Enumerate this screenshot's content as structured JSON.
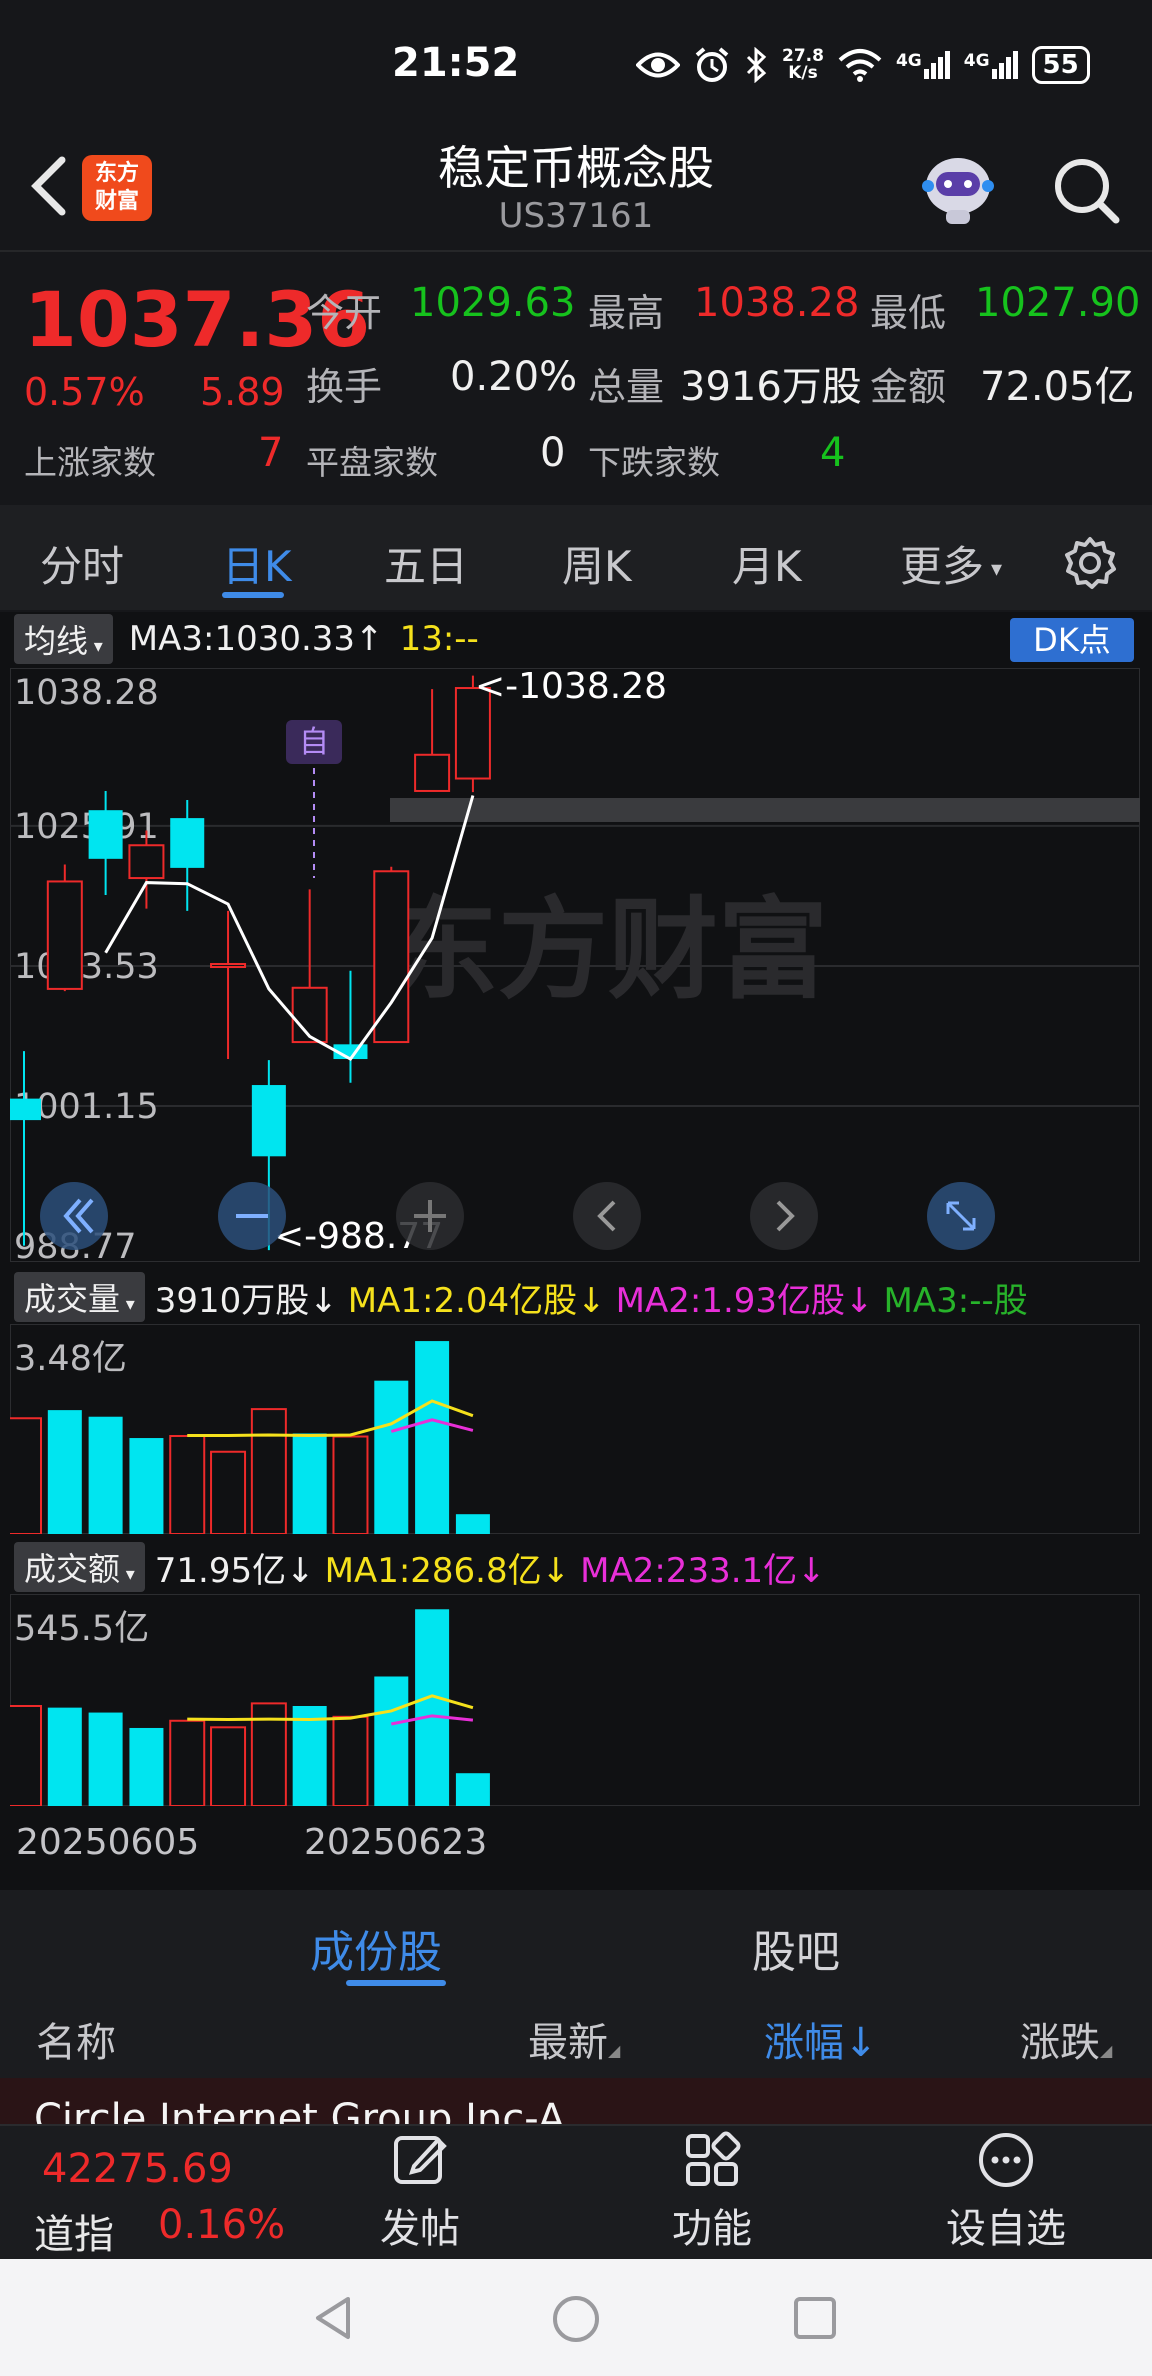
{
  "status_bar": {
    "time": "21:52",
    "net_speed_value": "27.8",
    "net_speed_unit": "K/s",
    "sim1": "4G",
    "sim2": "4G",
    "battery": "55"
  },
  "header": {
    "logo_text_1": "东方",
    "logo_text_2": "财富",
    "title": "稳定币概念股",
    "code": "US37161"
  },
  "quote": {
    "price": "1037.36",
    "change_pct": "0.57%",
    "change": "5.89",
    "open_label": "今开",
    "open": "1029.63",
    "high_label": "最高",
    "high": "1038.28",
    "low_label": "最低",
    "low": "1027.90",
    "turnover_label": "换手",
    "turnover": "0.20%",
    "volume_label": "总量",
    "volume": "3916万股",
    "amount_label": "金额",
    "amount": "72.05亿",
    "up_label": "上涨家数",
    "up_count": "7",
    "flat_label": "平盘家数",
    "flat_count": "0",
    "down_label": "下跌家数",
    "down_count": "4"
  },
  "tabs": [
    "分时",
    "日K",
    "五日",
    "周K",
    "月K",
    "更多"
  ],
  "active_tab": "日K",
  "kline": {
    "indicator_label": "均线",
    "ma3_text": "MA3:1030.33↑",
    "ma13_text": "13:--",
    "dk_label": "DK点",
    "self_marker": "自",
    "watermark": "东方财富",
    "max_label": "<-1038.28",
    "min_label": "<-988.77"
  },
  "volume_panel": {
    "label": "成交量",
    "value": "3910万股↓",
    "ma1": "MA1:2.04亿股↓",
    "ma2": "MA2:1.93亿股↓",
    "ma3": "MA3:--股",
    "axis_max": "3.48亿"
  },
  "amount_panel": {
    "label": "成交额",
    "value": "71.95亿↓",
    "ma1": "MA1:286.8亿↓",
    "ma2": "MA2:233.1亿↓",
    "axis_max": "545.5亿"
  },
  "dates": {
    "start": "20250605",
    "mid": "20250623"
  },
  "chart_data": {
    "type": "candlestick",
    "y_ticks": [
      "1038.28",
      "1025.91",
      "1013.53",
      "1001.15",
      "988.77"
    ],
    "ylim": [
      988.77,
      1038.28
    ],
    "candles": [
      {
        "open": 1001.8,
        "close": 999.9,
        "high": 1006.0,
        "low": 988.8,
        "dir": "down"
      },
      {
        "open": 1011.5,
        "close": 1021.0,
        "high": 1022.5,
        "low": 1011.3,
        "dir": "up"
      },
      {
        "open": 1027.3,
        "close": 1023.0,
        "high": 1029.0,
        "low": 1019.8,
        "dir": "down"
      },
      {
        "open": 1021.3,
        "close": 1024.2,
        "high": 1025.5,
        "low": 1018.6,
        "dir": "up"
      },
      {
        "open": 1026.6,
        "close": 1022.2,
        "high": 1028.2,
        "low": 1018.4,
        "dir": "down"
      },
      {
        "open": 1013.7,
        "close": 1013.7,
        "high": 1018.4,
        "low": 1005.3,
        "dir": "up"
      },
      {
        "open": 1003.0,
        "close": 996.7,
        "high": 1005.2,
        "low": 988.4,
        "dir": "down"
      },
      {
        "open": 1006.8,
        "close": 1011.6,
        "high": 1020.3,
        "low": 1006.8,
        "dir": "up"
      },
      {
        "open": 1005.3,
        "close": 1006.6,
        "high": 1013.1,
        "low": 1003.2,
        "dir": "down"
      },
      {
        "open": 1006.8,
        "close": 1021.9,
        "high": 1022.3,
        "low": 1006.8,
        "dir": "up"
      },
      {
        "open": 1029.0,
        "close": 1032.2,
        "high": 1038.0,
        "low": 1029.0,
        "dir": "up"
      },
      {
        "open": 1030.1,
        "close": 1038.1,
        "high": 1039.2,
        "low": 1028.9,
        "dir": "up"
      }
    ],
    "ma3": [
      null,
      null,
      1014.7,
      1020.9,
      1020.8,
      1019.0,
      1011.5,
      1007.3,
      1005.3,
      1010.3,
      1016.0,
      1028.6
    ],
    "volume": {
      "ymax_label": "3.48亿",
      "values": [
        2.28,
        2.44,
        2.31,
        1.89,
        1.93,
        1.62,
        2.46,
        1.98,
        1.92,
        3.02,
        3.8,
        0.39
      ],
      "dir": [
        "up",
        "down",
        "down",
        "down",
        "up",
        "up",
        "up",
        "down",
        "up",
        "down",
        "down",
        "down"
      ],
      "ma1": [
        null,
        null,
        null,
        null,
        1.94,
        1.94,
        1.95,
        1.94,
        1.95,
        2.17,
        2.62,
        2.33
      ],
      "ma2": [
        null,
        null,
        null,
        null,
        null,
        null,
        null,
        null,
        null,
        2.02,
        2.25,
        2.04
      ]
    },
    "amount": {
      "ymax_label": "545.5亿",
      "values": [
        305,
        300,
        285,
        238,
        260,
        240,
        313,
        305,
        272,
        395,
        600,
        100
      ],
      "dir": [
        "up",
        "down",
        "down",
        "down",
        "up",
        "up",
        "up",
        "down",
        "up",
        "down",
        "down",
        "down"
      ],
      "ma1": [
        null,
        null,
        null,
        null,
        265,
        264,
        265,
        264,
        268,
        290,
        336,
        300
      ],
      "ma2": [
        null,
        null,
        null,
        null,
        null,
        null,
        null,
        null,
        null,
        250,
        275,
        262
      ]
    }
  },
  "subtabs": [
    "成份股",
    "股吧"
  ],
  "active_subtab": "成份股",
  "list_header": {
    "name": "名称",
    "latest": "最新",
    "change_pct": "涨幅↓",
    "change": "涨跌"
  },
  "list_rows": [
    "Circle Internet Group Inc-A"
  ],
  "bottom_bar": {
    "index_value": "42275.69",
    "index_name": "道指",
    "index_pct": "0.16%",
    "post_label": "发帖",
    "function_label": "功能",
    "watchlist_label": "设自选"
  },
  "colors": {
    "up": "#ee2a2a",
    "down": "#00e5f0",
    "accent": "#3f8be8",
    "ma_yellow": "#f5e11c",
    "ma_magenta": "#e82fd8"
  }
}
